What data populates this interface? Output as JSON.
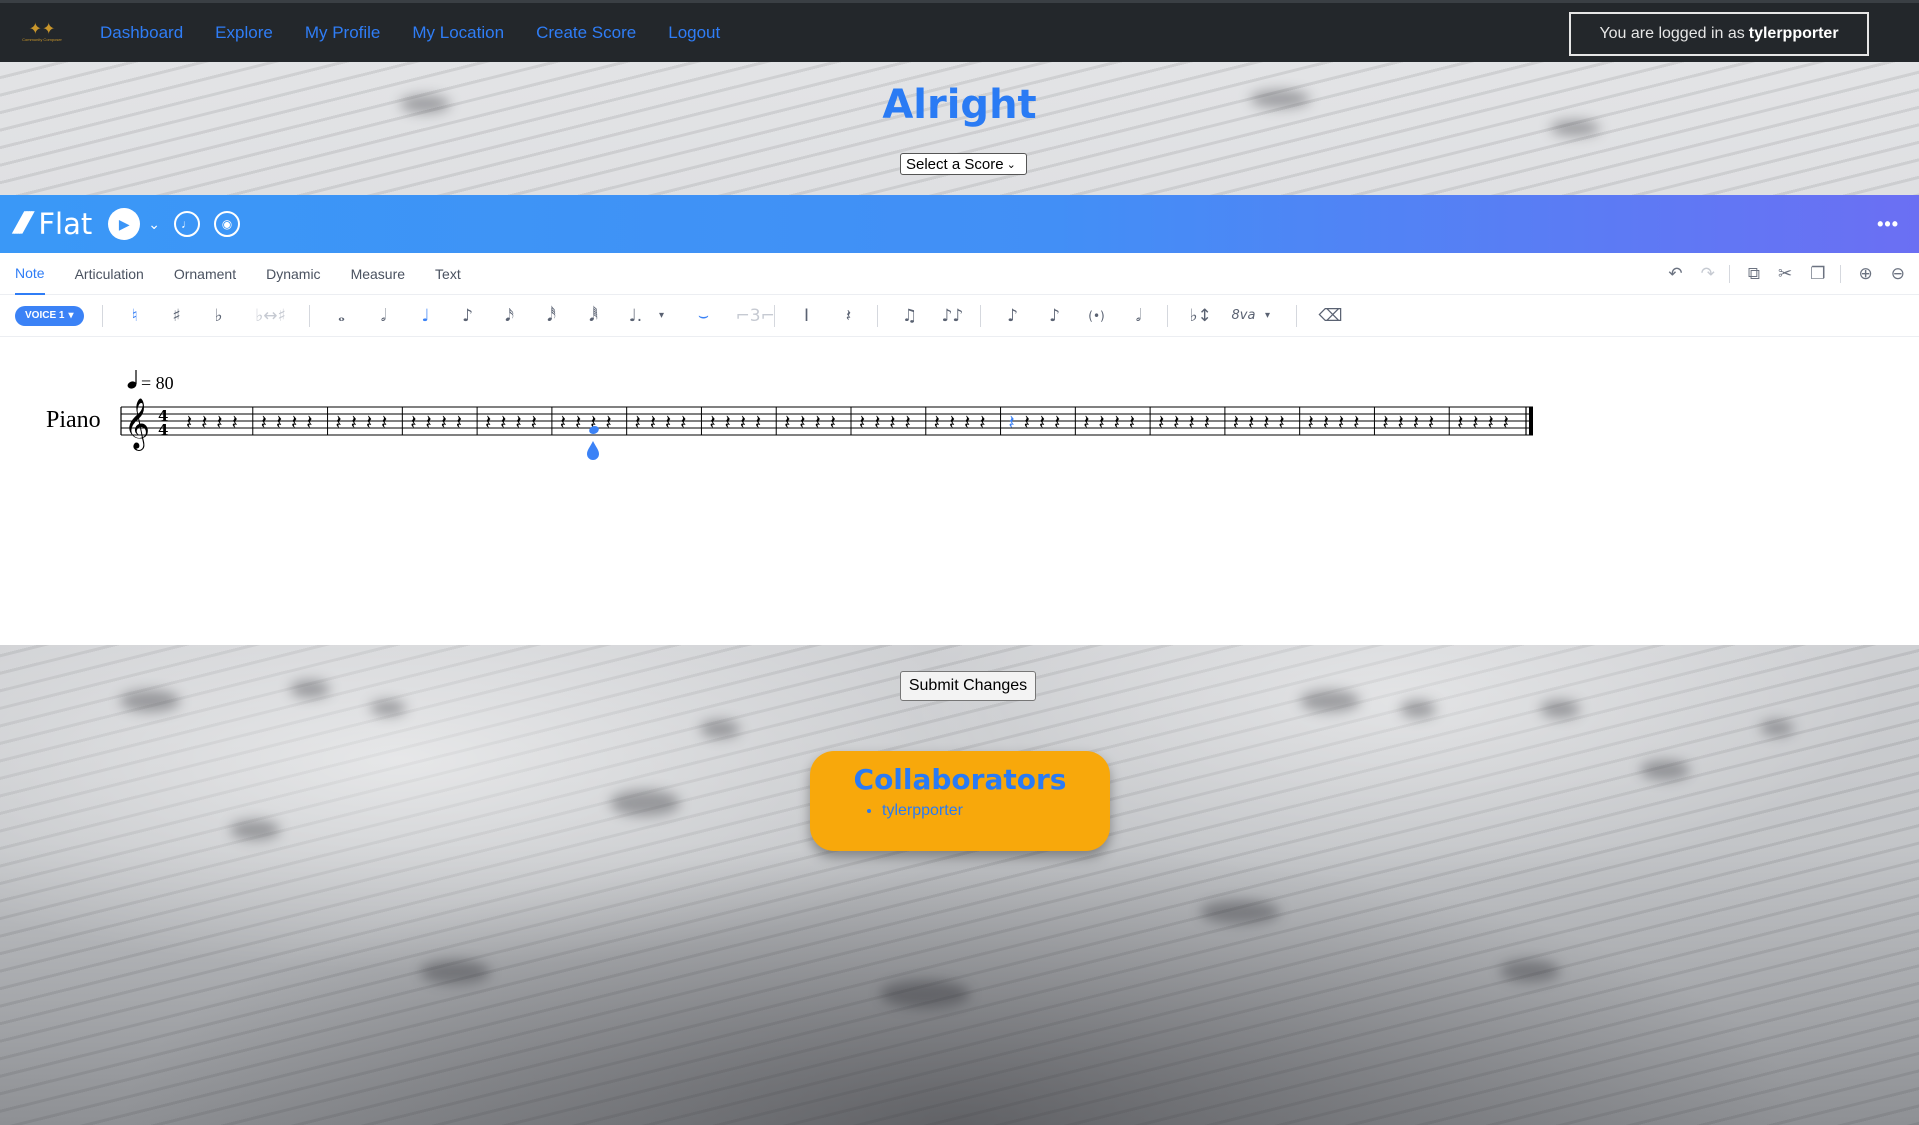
{
  "nav": {
    "logo_text": "Community Composer",
    "links": [
      "Dashboard",
      "Explore",
      "My Profile",
      "My Location",
      "Create Score",
      "Logout"
    ],
    "login_prefix": "You are logged in as",
    "username": "tylerpporter"
  },
  "page": {
    "title": "Alright",
    "score_select": "Select a Score"
  },
  "flat_editor": {
    "brand": "Flat",
    "more_label": "•••",
    "tabs": [
      "Note",
      "Articulation",
      "Ornament",
      "Dynamic",
      "Measure",
      "Text"
    ],
    "active_tab": "Note",
    "voice_label": "VOICE 1",
    "tempo_text": "= 80",
    "instrument": "Piano",
    "time_signature": "4/4",
    "measure_count": 18
  },
  "actions": {
    "submit_label": "Submit Changes"
  },
  "collaborators": {
    "title": "Collaborators",
    "names": [
      "tylerpporter"
    ]
  },
  "colors": {
    "navbar_bg": "#23272b",
    "link": "#2f7df6",
    "flat_gradient_start": "#3a98f7",
    "flat_gradient_end": "#6b6ff3",
    "collab_bg": "#f8a80b"
  }
}
